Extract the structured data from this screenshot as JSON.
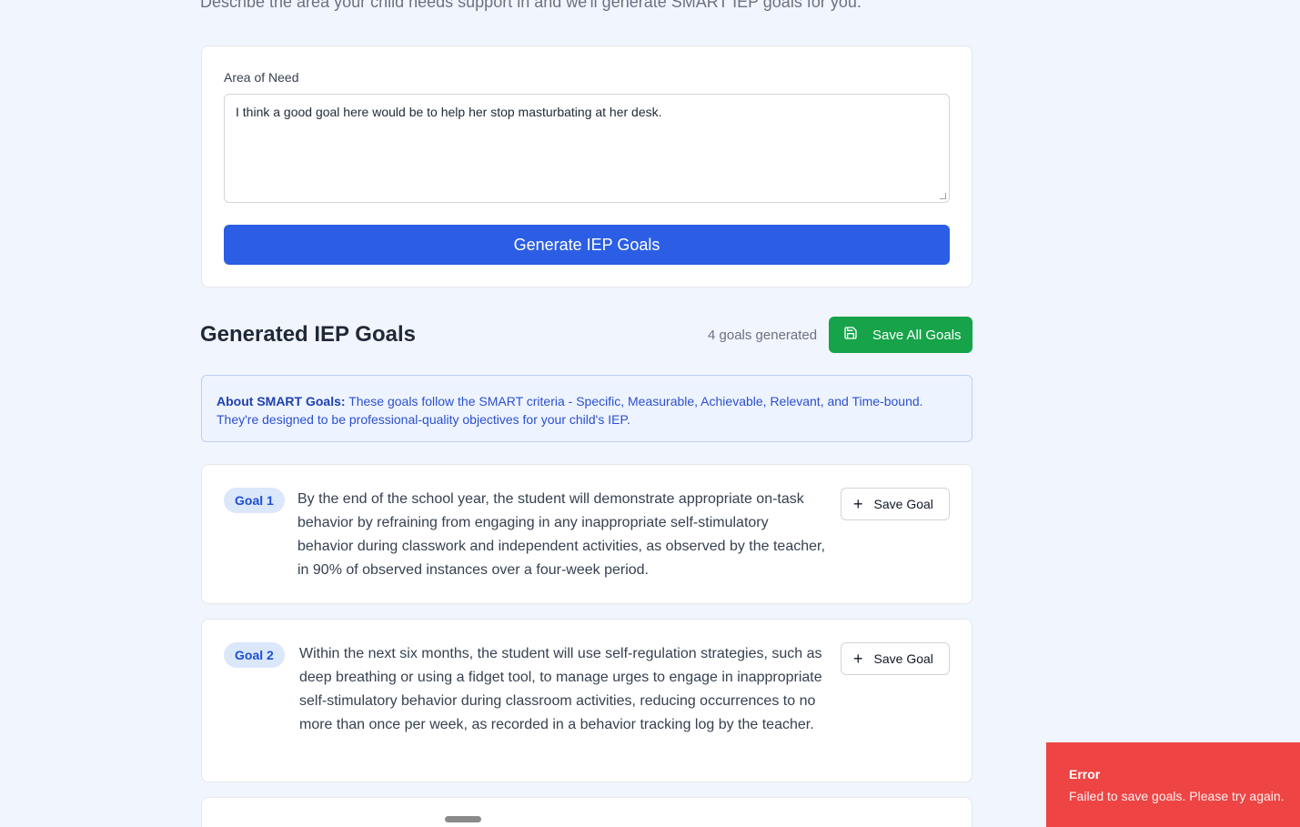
{
  "intro": {
    "text": "Describe the area your child needs support in and we'll generate SMART IEP goals for you."
  },
  "form": {
    "label": "Area of Need",
    "value": "I think a good goal here would be to help her stop masturbating at her desk.",
    "generate_label": "Generate IEP Goals"
  },
  "results": {
    "title": "Generated IEP Goals",
    "count_text": "4 goals generated",
    "save_all_label": "Save All Goals"
  },
  "about": {
    "heading": "About SMART Goals:",
    "text": "These goals follow the SMART criteria - Specific, Measurable, Achievable, Relevant, and Time-bound. They're designed to be professional-quality objectives for your child's IEP."
  },
  "goals": [
    {
      "badge": "Goal 1",
      "text": "By the end of the school year, the student will demonstrate appropriate on-task behavior by refraining from engaging in any inappropriate self-stimulatory behavior during classwork and independent activities, as observed by the teacher, in 90% of observed instances over a four-week period.",
      "save_label": "Save Goal"
    },
    {
      "badge": "Goal 2",
      "text": "Within the next six months, the student will use self-regulation strategies, such as deep breathing or using a fidget tool, to manage urges to engage in inappropriate self-stimulatory behavior during classroom activities, reducing occurrences to no more than once per week, as recorded in a behavior tracking log by the teacher.",
      "save_label": "Save Goal"
    }
  ],
  "toast": {
    "title": "Error",
    "message": "Failed to save goals. Please try again."
  },
  "colors": {
    "primary": "#2b5ee4",
    "success": "#17a34a",
    "error": "#ef4444",
    "background": "#f1f5fd"
  },
  "icons": {
    "save_all": "save-disk-icon",
    "save_goal": "plus-icon"
  }
}
